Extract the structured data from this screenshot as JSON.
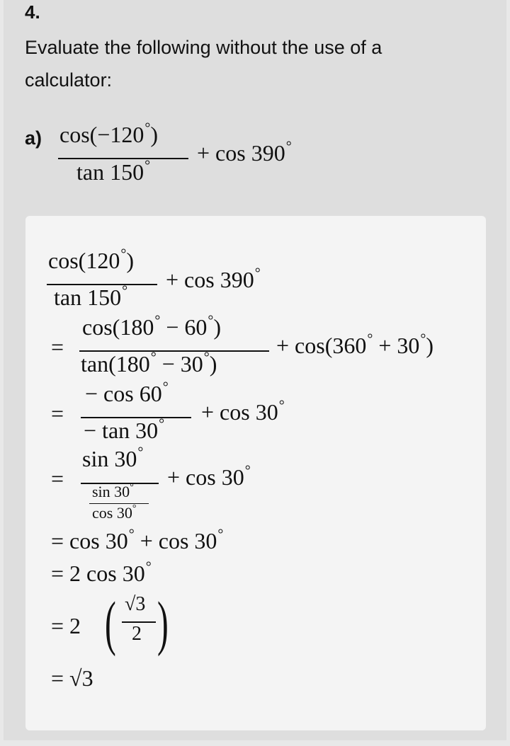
{
  "question": {
    "number": "4.",
    "prompt": "Evaluate the following without the use of a calculator:",
    "part_label": "a)"
  },
  "expr": {
    "num": "cos(−120°)",
    "den": "tan 150°",
    "tail": "+ cos 390°"
  },
  "solution": {
    "l1_num": "cos(120°)",
    "l1_den": "tan 150°",
    "l1_tail": "+ cos 390°",
    "l2_num": "cos(180° − 60°)",
    "l2_den": "tan(180° − 30°)",
    "l2_tail": "+ cos(360° + 30°)",
    "l3_num": "− cos 60°",
    "l3_den": "− tan 30°",
    "l3_tail": "+ cos 30°",
    "l4_num": "sin 30°",
    "l4_den_num": "sin 30°",
    "l4_den_den": "cos 30°",
    "l4_tail": "+ cos 30°",
    "l5": "= cos 30° + cos 30°",
    "l6": "= 2 cos 30°",
    "l7_prefix": "= 2",
    "l7_num": "√3",
    "l7_den": "2",
    "l8": "= √3",
    "eq": "="
  }
}
